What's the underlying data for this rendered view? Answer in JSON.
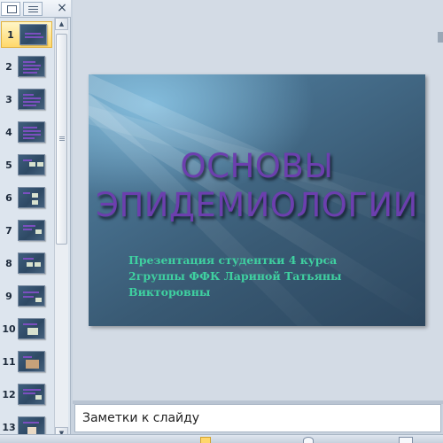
{
  "thumbnail_pane": {
    "close_label": "×",
    "slides": [
      {
        "number": "1",
        "selected": true
      },
      {
        "number": "2",
        "selected": false
      },
      {
        "number": "3",
        "selected": false
      },
      {
        "number": "4",
        "selected": false
      },
      {
        "number": "5",
        "selected": false
      },
      {
        "number": "6",
        "selected": false
      },
      {
        "number": "7",
        "selected": false
      },
      {
        "number": "8",
        "selected": false
      },
      {
        "number": "9",
        "selected": false
      },
      {
        "number": "10",
        "selected": false
      },
      {
        "number": "11",
        "selected": false
      },
      {
        "number": "12",
        "selected": false
      },
      {
        "number": "13",
        "selected": false
      }
    ]
  },
  "slide": {
    "title_lines": [
      "ОСНОВЫ",
      "ЭПИДЕМИОЛОГИИ"
    ],
    "subtitle_lines": [
      "Презентация студентки 4 курса",
      "2группы ФФК Лариной Татьяны",
      "Викторовны"
    ]
  },
  "notes": {
    "placeholder": "Заметки к слайду"
  },
  "colors": {
    "title": "#6c3fae",
    "subtitle": "#3fd0a0",
    "selection": "#ffd86a"
  }
}
